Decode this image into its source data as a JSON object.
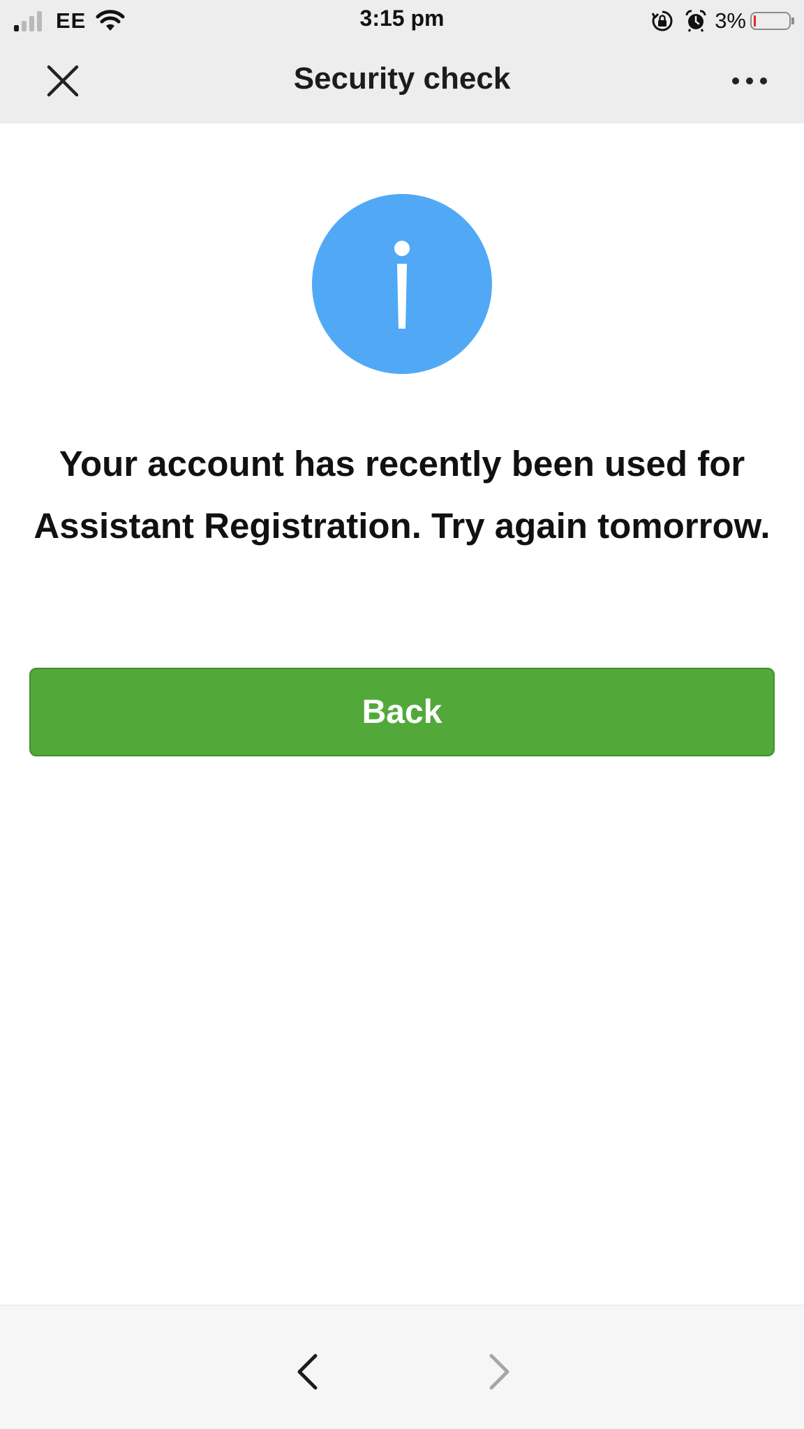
{
  "status_bar": {
    "carrier": "EE",
    "time": "3:15 pm",
    "battery_percent": "3%",
    "signal_bars_active": 1,
    "signal_bars_total": 4,
    "battery_level": 0.03,
    "icons": [
      "signal-icon",
      "wifi-icon",
      "orientation-lock-icon",
      "alarm-icon",
      "battery-icon"
    ]
  },
  "header": {
    "title": "Security check",
    "close_icon": "close-icon",
    "more_icon": "more-options-icon"
  },
  "main": {
    "icon": "info-icon",
    "message": "Your account has recently been used for Assistant Registration. Try again tomorrow.",
    "back_button_label": "Back"
  },
  "toolbar": {
    "back_icon": "chevron-left-icon",
    "forward_icon": "chevron-right-icon"
  },
  "colors": {
    "header_bg": "#ededed",
    "info_blue": "#51a9f6",
    "button_green": "#52a93a",
    "battery_low": "#e0262b",
    "toolbar_bg": "#f6f6f6"
  }
}
